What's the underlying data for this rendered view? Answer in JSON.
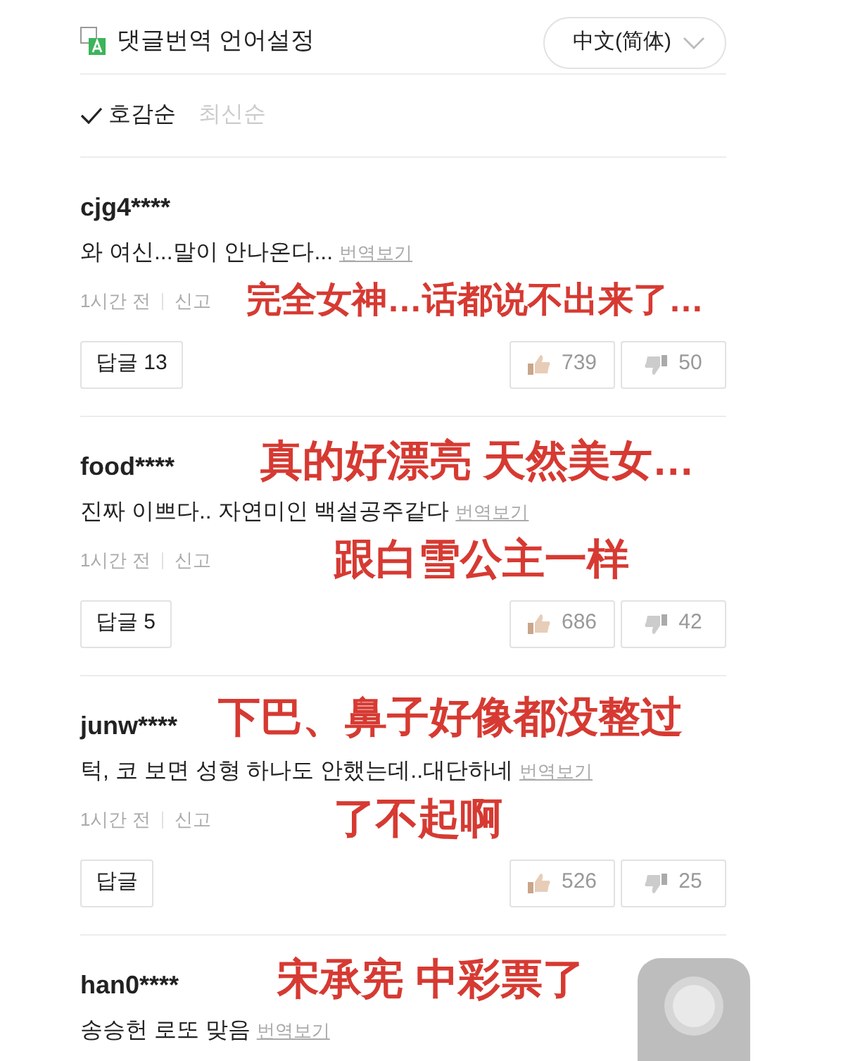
{
  "header": {
    "title": "댓글번역 언어설정",
    "language": "中文(简体)"
  },
  "sort_options": [
    {
      "label": "호감순",
      "selected": true
    },
    {
      "label": "최신순",
      "selected": false
    }
  ],
  "comments": [
    {
      "user": "cjg4****",
      "text": "와 여신...말이 안나온다...",
      "translate_link": "번역보기",
      "time": "1시간 전",
      "report": "신고",
      "reply": "답글",
      "reply_count": "13",
      "likes": "739",
      "dislikes": "50",
      "caption_lines": [
        "完全女神…话都说不出来了…"
      ]
    },
    {
      "user": "food****",
      "text": "진짜 이쁘다.. 자연미인  백설공주같다",
      "translate_link": "번역보기",
      "time": "1시간 전",
      "report": "신고",
      "reply": "답글",
      "reply_count": "5",
      "likes": "686",
      "dislikes": "42",
      "caption_lines": [
        "真的好漂亮 天然美女…",
        "跟白雪公主一样"
      ]
    },
    {
      "user": "junw****",
      "text": "턱, 코 보면 성형 하나도 안했는데..대단하네",
      "translate_link": "번역보기",
      "time": "1시간 전",
      "report": "신고",
      "reply": "답글",
      "likes": "526",
      "dislikes": "25",
      "caption_lines": [
        "下巴、鼻子好像都没整过",
        "了不起啊"
      ]
    },
    {
      "user": "han0****",
      "text": "송승헌 로또 맞음",
      "translate_link": "번역보기",
      "caption_lines": [
        "宋承宪 中彩票了"
      ]
    }
  ]
}
